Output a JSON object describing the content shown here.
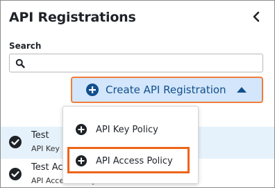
{
  "panel": {
    "title": "API Registrations",
    "collapse_icon": "chevron-left-icon"
  },
  "search": {
    "label": "Search",
    "value": "",
    "placeholder": "",
    "icon": "search-icon"
  },
  "create_button": {
    "label": "Create API Registration",
    "icon": "plus-circle-icon",
    "caret_icon": "caret-up-icon",
    "state": "expanded"
  },
  "dropdown": {
    "items": [
      {
        "label": "API Key Policy",
        "icon": "plus-circle-icon"
      },
      {
        "label": "API Access Policy",
        "icon": "plus-circle-icon",
        "highlighted": true
      }
    ]
  },
  "registrations": [
    {
      "name": "Test",
      "type": "API Key",
      "icon": "check-circle-icon",
      "selected": true
    },
    {
      "name": "Test Ac",
      "type": "API Access Policy",
      "icon": "check-circle-icon",
      "selected": false
    }
  ],
  "colors": {
    "accent": "#124f8c",
    "button_bg": "#d3e6fb",
    "focus_ring": "#f07d3a",
    "highlight_outline": "#ec6419",
    "selected_row_bg": "#e6f2fb",
    "icon_dark": "#1f2328"
  }
}
